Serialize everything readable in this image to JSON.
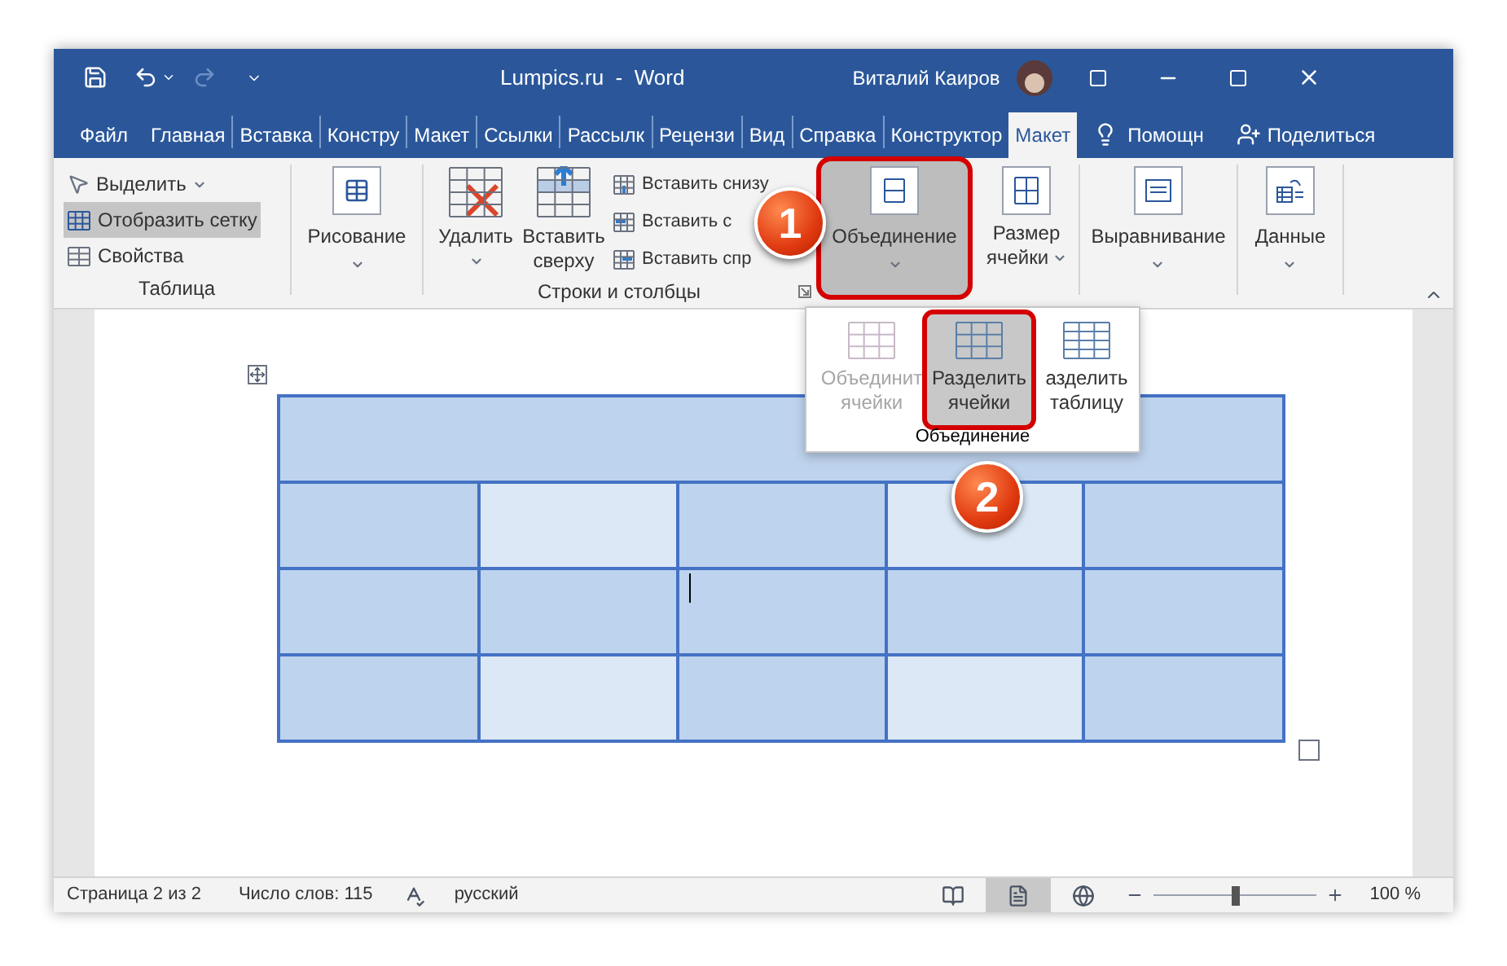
{
  "title_bar": {
    "title": "Lumpics.ru  -  Word",
    "user": "Виталий Каиров",
    "redo_disabled": true
  },
  "tabs": [
    {
      "label": "Файл",
      "selected": false
    },
    {
      "label": "Главная",
      "selected": false
    },
    {
      "label": "Вставка",
      "selected": false
    },
    {
      "label": "Констру",
      "selected": false
    },
    {
      "label": "Макет",
      "selected": false
    },
    {
      "label": "Ссылки",
      "selected": false
    },
    {
      "label": "Рассылк",
      "selected": false
    },
    {
      "label": "Рецензи",
      "selected": false
    },
    {
      "label": "Вид",
      "selected": false
    },
    {
      "label": "Справка",
      "selected": false
    },
    {
      "label": "Конструктор",
      "selected": false
    },
    {
      "label": "Макет",
      "selected": true
    }
  ],
  "tell_me": "Помощн",
  "share": "Поделиться",
  "ribbon": {
    "table_group": {
      "label": "Таблица",
      "items": [
        {
          "kind": "select",
          "label": "Выделить",
          "selected": false
        },
        {
          "kind": "gridlines",
          "label": "Отобразить сетку",
          "selected": true
        },
        {
          "kind": "properties",
          "label": "Свойства",
          "selected": false
        }
      ]
    },
    "draw": {
      "label": "Рисование"
    },
    "rows_group": {
      "label": "Строки и столбцы",
      "large": [
        {
          "kind": "delete",
          "lines": [
            "Удалить"
          ]
        },
        {
          "kind": "insert_above",
          "lines": [
            "Вставить",
            "сверху"
          ]
        }
      ],
      "small": [
        {
          "kind": "below",
          "label": "Вставить снизу"
        },
        {
          "kind": "left",
          "label": "Вставить с"
        },
        {
          "kind": "right",
          "label": "Вставить спр"
        }
      ]
    },
    "merge": {
      "label": "Объединение",
      "pressed": true
    },
    "buttons": [
      {
        "kind": "cell_size",
        "lines": [
          "Размер",
          "ячейки"
        ]
      },
      {
        "kind": "align",
        "lines": [
          "Выравнивание"
        ]
      },
      {
        "kind": "data",
        "lines": [
          "Данные"
        ]
      }
    ]
  },
  "dropdown": {
    "label": "Объединение",
    "items": [
      {
        "kind": "merge_cells",
        "lines": [
          "Объединит",
          "ячейки"
        ],
        "disabled": true,
        "selected": false
      },
      {
        "kind": "split_cells",
        "lines": [
          "Разделить",
          "ячейки"
        ],
        "disabled": false,
        "selected": true
      },
      {
        "kind": "split_table",
        "lines": [
          "азделить",
          "таблицу"
        ],
        "disabled": false,
        "selected": false
      }
    ]
  },
  "callouts": [
    "1",
    "2"
  ],
  "table": {
    "rows": [
      {
        "cells": [
          {
            "color": "#bed3ed"
          }
        ]
      },
      {
        "cells": [
          {
            "color": "#bed3ed"
          },
          {
            "color": "#dce8f5"
          },
          {
            "color": "#bed3ed"
          },
          {
            "color": "#dce8f5"
          },
          {
            "color": "#bed3ed"
          }
        ]
      },
      {
        "cells": [
          {
            "color": "#bed3ed"
          },
          {
            "color": "#bed3ed"
          },
          {
            "color": "#bed3ed"
          },
          {
            "color": "#bed3ed"
          },
          {
            "color": "#bed3ed"
          }
        ]
      },
      {
        "cells": [
          {
            "color": "#bed3ed"
          },
          {
            "color": "#dce8f5"
          },
          {
            "color": "#bed3ed"
          },
          {
            "color": "#dce8f5"
          },
          {
            "color": "#bed3ed"
          }
        ]
      }
    ]
  },
  "status_bar": {
    "page": "Страница 2 из 2",
    "words": "Число слов: 115",
    "language": "русский",
    "views": [
      {
        "kind": "read",
        "selected": false
      },
      {
        "kind": "print",
        "selected": true
      },
      {
        "kind": "web",
        "selected": false
      }
    ],
    "zoom": {
      "level": 0.5,
      "reading": "100 %"
    }
  }
}
